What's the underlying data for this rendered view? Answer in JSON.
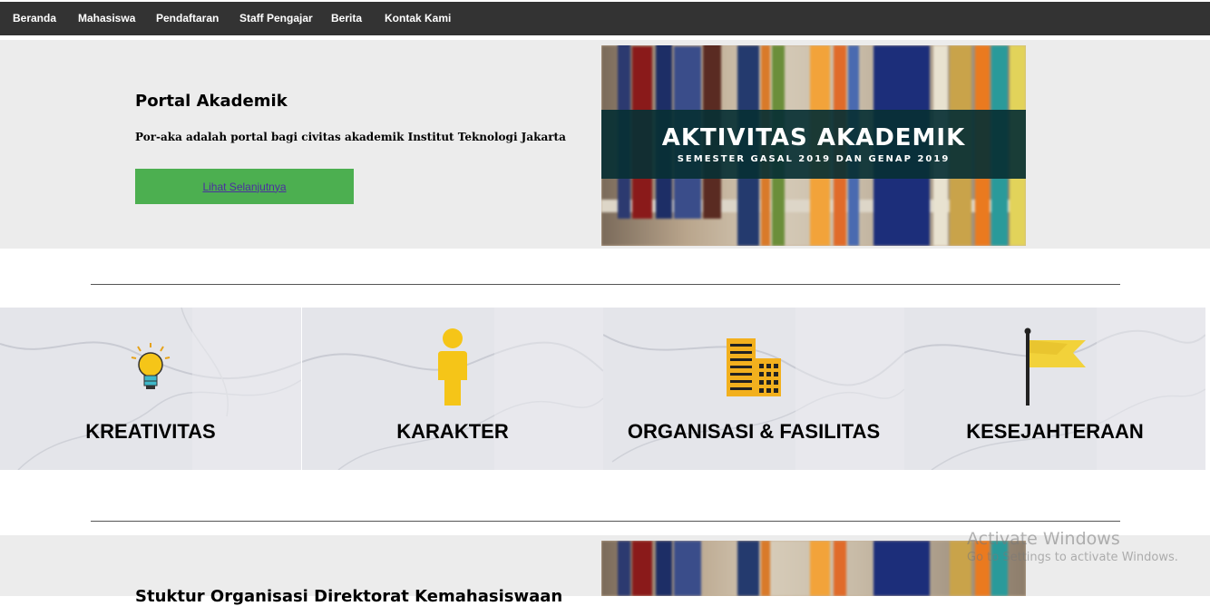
{
  "nav": {
    "items": [
      "Beranda",
      "Mahasiswa",
      "Pendaftaran",
      "Staff Pengajar",
      "Berita",
      "Kontak Kami"
    ]
  },
  "hero": {
    "title": "Portal Akademik",
    "description": "Por-aka adalah portal bagi civitas akademik Institut Teknologi Jakarta",
    "button_label": "Lihat Selanjutnya",
    "banner_title": "AKTIVITAS AKADEMIK",
    "banner_subtitle": "SEMESTER GASAL 2019 DAN GENAP 2019"
  },
  "cards": [
    {
      "label": "KREATIVITAS",
      "icon": "lightbulb-icon"
    },
    {
      "label": "KARAKTER",
      "icon": "person-icon"
    },
    {
      "label": "ORGANISASI & FASILITAS",
      "icon": "building-icon"
    },
    {
      "label": "KESEJAHTERAAN",
      "icon": "flag-icon"
    }
  ],
  "section2": {
    "title": "Stuktur Organisasi Direktorat Kemahasiswaan"
  },
  "watermark": {
    "line1": "Activate Windows",
    "line2": "Go to Settings to activate Windows."
  },
  "colors": {
    "nav_bg": "#333333",
    "hero_bg": "#ececec",
    "button_bg": "#4caf50",
    "banner_overlay": "#083034",
    "icon_yellow": "#f5c518"
  }
}
